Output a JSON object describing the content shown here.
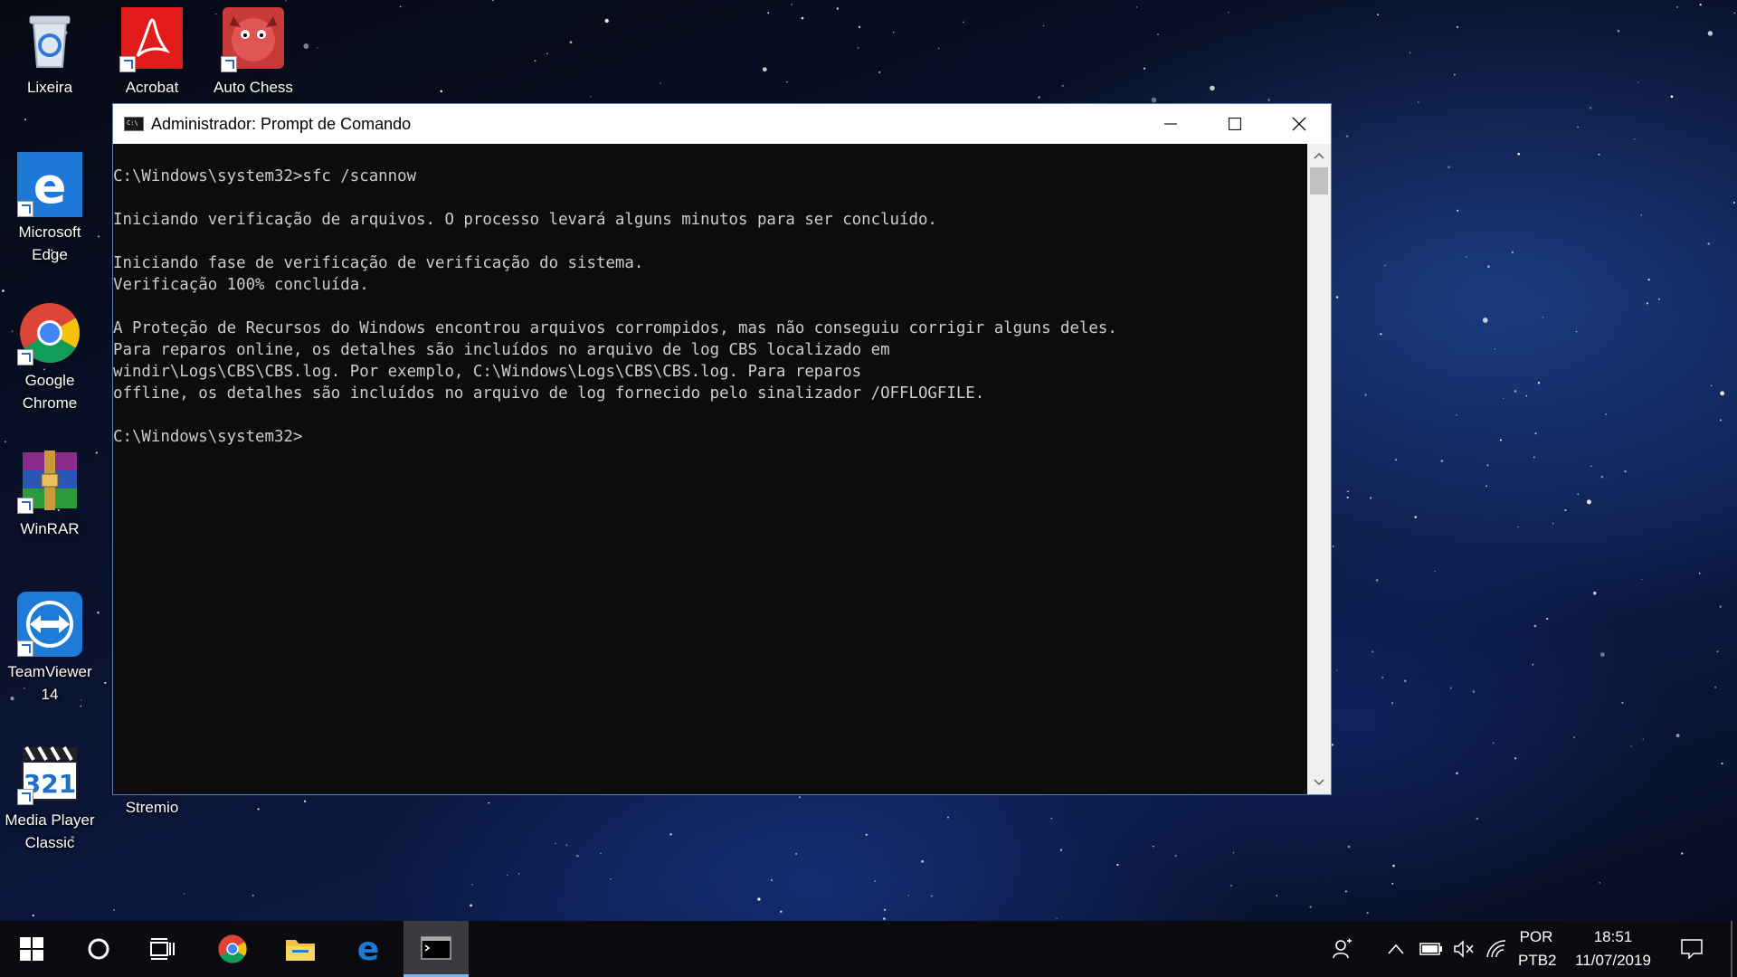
{
  "desktop": {
    "icons": [
      {
        "label": "Lixeira"
      },
      {
        "label": "Acrobat"
      },
      {
        "label": "Auto Chess"
      },
      {
        "label": "Microsoft Edge"
      },
      {
        "label": "Google Chrome"
      },
      {
        "label": "WinRAR"
      },
      {
        "label": "TeamViewer 14"
      },
      {
        "label": "Media Player Classic"
      },
      {
        "label": "Stremio"
      }
    ]
  },
  "window": {
    "title": "Administrador: Prompt de Comando",
    "minimize_icon": "minimize-icon",
    "maximize_icon": "maximize-icon",
    "close_icon": "close-icon",
    "console_lines": [
      "",
      "C:\\Windows\\system32>sfc /scannow",
      "",
      "Iniciando verificação de arquivos. O processo levará alguns minutos para ser concluído.",
      "",
      "Iniciando fase de verificação de verificação do sistema.",
      "Verificação 100% concluída.",
      "",
      "A Proteção de Recursos do Windows encontrou arquivos corrompidos, mas não conseguiu corrigir alguns deles.",
      "Para reparos online, os detalhes são incluídos no arquivo de log CBS localizado em",
      "windir\\Logs\\CBS\\CBS.log. Por exemplo, C:\\Windows\\Logs\\CBS\\CBS.log. Para reparos",
      "offline, os detalhes são incluídos no arquivo de log fornecido pelo sinalizador /OFFLOGFILE.",
      "",
      "C:\\Windows\\system32>"
    ]
  },
  "taskbar": {
    "language": "POR",
    "layout": "PTB2",
    "time": "18:51",
    "date": "11/07/2019"
  },
  "colors": {
    "console_bg": "#0c0c0c",
    "console_text": "#cccccc",
    "taskbar_bg": "#0a0a0f",
    "accent": "#7db2e8"
  }
}
